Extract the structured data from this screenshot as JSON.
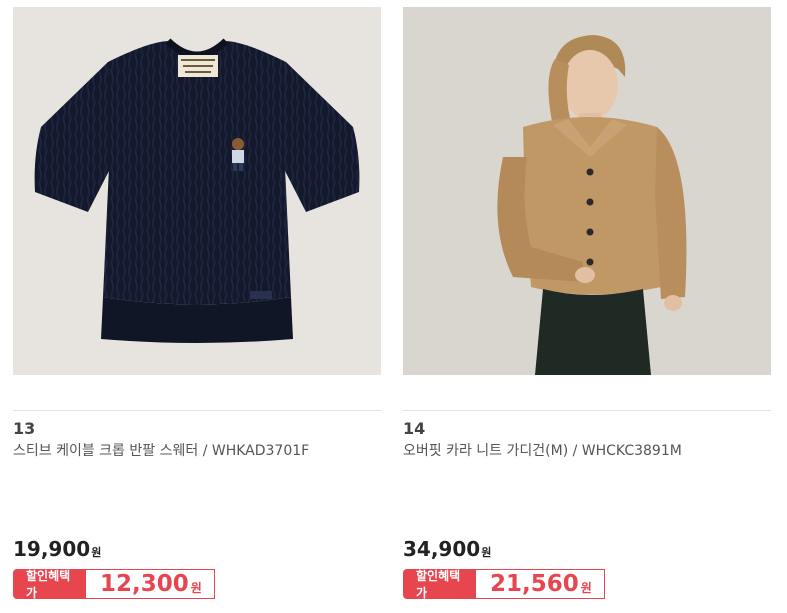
{
  "products": [
    {
      "rank": "13",
      "name": "스티브 케이블 크롭 반팔 스웨터 / WHKAD3701F",
      "price": "19,900",
      "price_unit": "원",
      "sale_label": "할인혜택가",
      "sale_price": "12,300",
      "sale_unit": "원",
      "image_icon": "navy-cable-knit-sweater-image"
    },
    {
      "rank": "14",
      "name": "오버핏 카라 니트 가디건(M) / WHCKC3891M",
      "price": "34,900",
      "price_unit": "원",
      "sale_label": "할인혜택가",
      "sale_price": "21,560",
      "sale_unit": "원",
      "image_icon": "camel-knit-cardigan-model-image"
    }
  ],
  "colors": {
    "accent": "#e8464f",
    "divider": "#e2e2e2"
  }
}
